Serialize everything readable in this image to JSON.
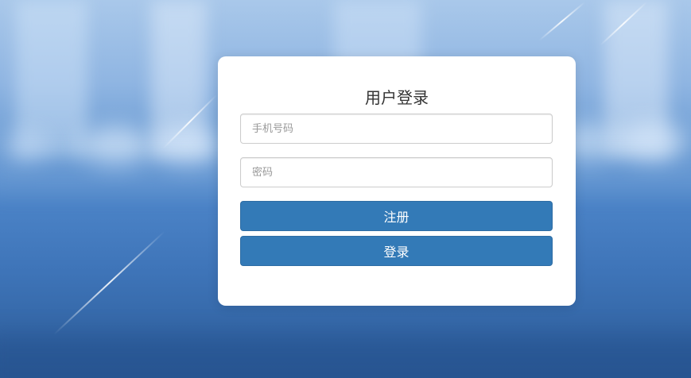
{
  "login": {
    "title": "用户登录",
    "phone_placeholder": "手机号码",
    "password_placeholder": "密码",
    "register_label": "注册",
    "login_label": "登录"
  },
  "colors": {
    "primary_button": "#337ab7",
    "card_background": "#ffffff"
  }
}
